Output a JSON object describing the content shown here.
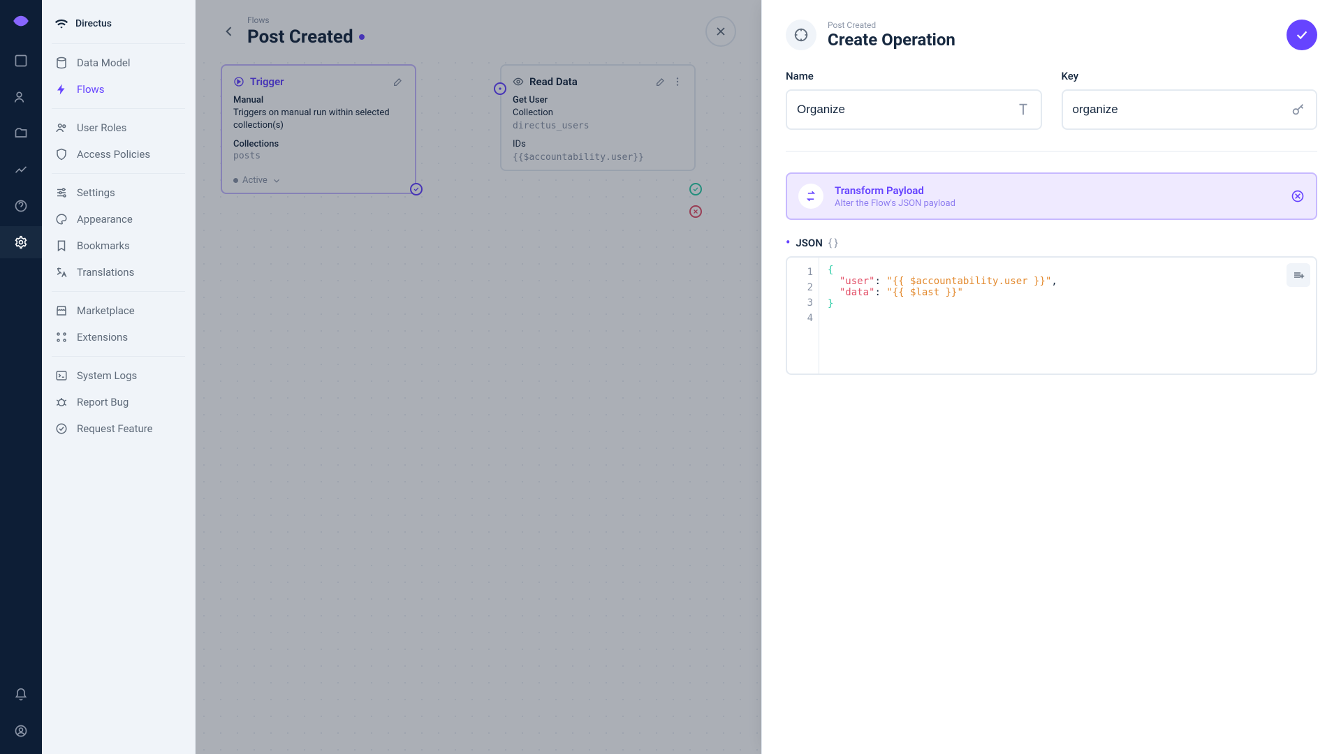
{
  "app_name": "Directus",
  "rail": {
    "items": [
      "content",
      "users",
      "files",
      "insights",
      "docs",
      "settings",
      "notifications",
      "account"
    ],
    "active": "settings"
  },
  "sidebar": {
    "title": "Directus",
    "items": [
      {
        "label": "Data Model"
      },
      {
        "label": "Flows",
        "active": true
      },
      {
        "label": "User Roles"
      },
      {
        "label": "Access Policies"
      },
      {
        "label": "Settings"
      },
      {
        "label": "Appearance"
      },
      {
        "label": "Bookmarks"
      },
      {
        "label": "Translations"
      },
      {
        "label": "Marketplace"
      },
      {
        "label": "Extensions"
      },
      {
        "label": "System Logs"
      },
      {
        "label": "Report Bug"
      },
      {
        "label": "Request Feature"
      }
    ]
  },
  "header": {
    "breadcrumb": "Flows",
    "title": "Post Created"
  },
  "flow": {
    "trigger": {
      "title": "Trigger",
      "type_label": "Manual",
      "description": "Triggers on manual run within selected collection(s)",
      "field_label": "Collections",
      "field_value": "posts",
      "status": "Active"
    },
    "read": {
      "title": "Read Data",
      "name": "Get User",
      "collection_label": "Collection",
      "collection_value": "directus_users",
      "ids_label": "IDs",
      "ids_value": "{{$accountability.user}}"
    }
  },
  "drawer": {
    "subtitle": "Post Created",
    "title": "Create Operation",
    "name_label": "Name",
    "name_value": "Organize",
    "key_label": "Key",
    "key_value": "organize",
    "operation": {
      "title": "Transform Payload",
      "desc": "Alter the Flow's JSON payload"
    },
    "json_label": "JSON",
    "json_braces": "{ }",
    "code": {
      "line1_key": "\"user\"",
      "line1_val": "\"{{ $accountability.user }}\"",
      "line2_key": "\"data\"",
      "line2_val": "\"{{ $last }}\""
    }
  }
}
